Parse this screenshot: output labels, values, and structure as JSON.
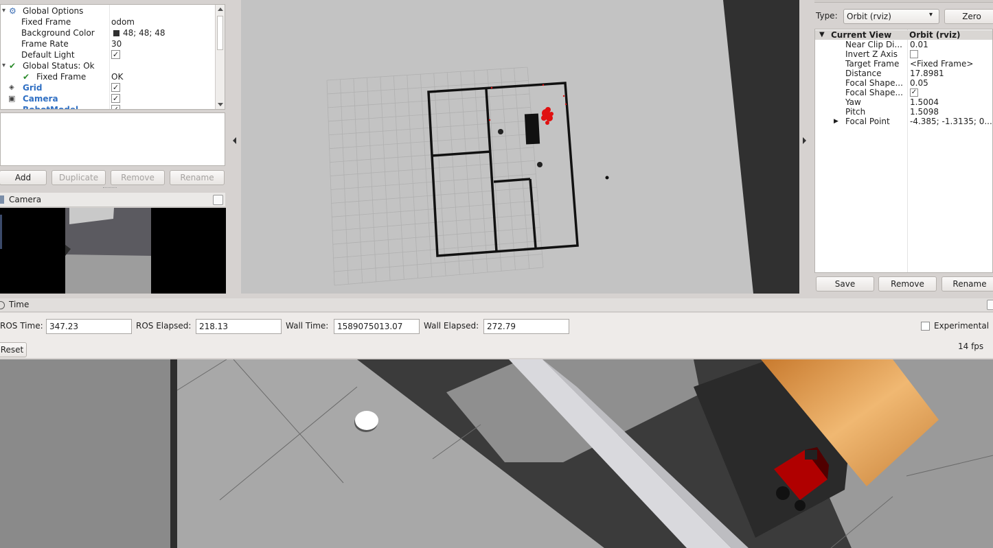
{
  "displays": {
    "tree": [
      {
        "label": "Global Options",
        "value": ""
      },
      {
        "label": "Fixed Frame",
        "value": "odom"
      },
      {
        "label": "Background Color",
        "value": "48; 48; 48"
      },
      {
        "label": "Frame Rate",
        "value": "30"
      },
      {
        "label": "Default Light",
        "value": ""
      },
      {
        "label": "Global Status: Ok",
        "value": ""
      },
      {
        "label": "Fixed Frame",
        "value": "OK"
      },
      {
        "label": "Grid",
        "value": ""
      },
      {
        "label": "Camera",
        "value": ""
      },
      {
        "label": "RobotModel",
        "value": ""
      }
    ],
    "buttons": {
      "add": "Add",
      "duplicate": "Duplicate",
      "remove": "Remove",
      "rename": "Rename"
    },
    "colors": {
      "background_swatch": "#303030",
      "ok_check": "#2a8a2a",
      "display_name": "#2f6fc3"
    }
  },
  "camera_panel": {
    "title": "Camera"
  },
  "views": {
    "type_label": "Type:",
    "type_value": "Orbit (rviz)",
    "zero_button": "Zero",
    "header": {
      "name": "Current View",
      "type": "Orbit (rviz)"
    },
    "props": [
      {
        "key": "Near Clip Di...",
        "value": "0.01"
      },
      {
        "key": "Invert Z Axis",
        "value": ""
      },
      {
        "key": "Target Frame",
        "value": "<Fixed Frame>"
      },
      {
        "key": "Distance",
        "value": "17.8981"
      },
      {
        "key": "Focal Shape...",
        "value": "0.05"
      },
      {
        "key": "Focal Shape...",
        "value": ""
      },
      {
        "key": "Yaw",
        "value": "1.5004"
      },
      {
        "key": "Pitch",
        "value": "1.5098"
      },
      {
        "key": "Focal Point",
        "value": "-4.385; -1.3135; 0...."
      }
    ],
    "buttons": {
      "save": "Save",
      "remove": "Remove",
      "rename": "Rename"
    }
  },
  "time": {
    "title": "Time",
    "ros_time_label": "ROS Time:",
    "ros_time": "347.23",
    "ros_elapsed_label": "ROS Elapsed:",
    "ros_elapsed": "218.13",
    "wall_time_label": "Wall Time:",
    "wall_time": "1589075013.07",
    "wall_elapsed_label": "Wall Elapsed:",
    "wall_elapsed": "272.79",
    "experimental_label": "Experimental",
    "reset_button": "Reset",
    "fps": "14 fps"
  }
}
